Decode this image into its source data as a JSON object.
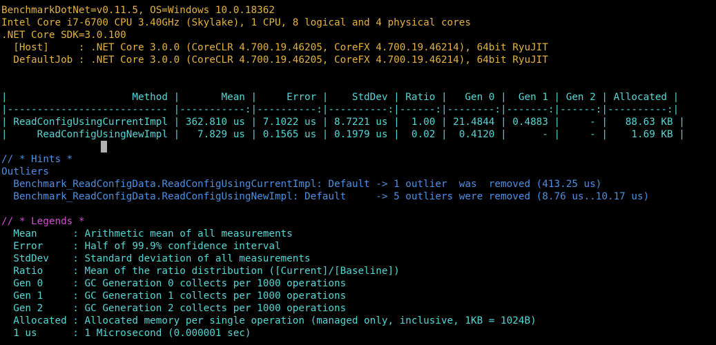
{
  "environment": {
    "line1": "BenchmarkDotNet=v0.11.5, OS=Windows 10.0.18362",
    "line2": "Intel Core i7-6700 CPU 3.40GHz (Skylake), 1 CPU, 8 logical and 4 physical cores",
    "line3": ".NET Core SDK=3.0.100",
    "line4": "  [Host]     : .NET Core 3.0.0 (CoreCLR 4.700.19.46205, CoreFX 4.700.19.46214), 64bit RyuJIT",
    "line5": "  DefaultJob : .NET Core 3.0.0 (CoreCLR 4.700.19.46205, CoreFX 4.700.19.46214), 64bit RyuJIT"
  },
  "table": {
    "header": "|                     Method |       Mean |     Error |    StdDev | Ratio |   Gen 0 |  Gen 1 | Gen 2 | Allocated |",
    "separator": "|--------------------------- |-----------:|----------:|----------:|------:|--------:|-------:|------:|----------:|",
    "rows": [
      "| ReadConfigUsingCurrentImpl | 362.810 us | 7.1022 us | 8.7221 us |  1.00 | 21.4844 | 0.4883 |     - |   88.63 KB |",
      "|     ReadConfigUsingNewImpl |   7.829 us | 0.1565 us | 0.1979 us |  0.02 |  0.4120 |      - |     - |    1.69 KB |"
    ]
  },
  "hints": {
    "title": "// * Hints *",
    "subtitle": "Outliers",
    "items": [
      "  Benchmark_ReadConfigData.ReadConfigUsingCurrentImpl: Default -> 1 outlier  was  removed (413.25 us)",
      "  Benchmark_ReadConfigData.ReadConfigUsingNewImpl: Default     -> 5 outliers were removed (8.76 us..10.17 us)"
    ]
  },
  "legends": {
    "title": "// * Legends *",
    "items": [
      "  Mean      : Arithmetic mean of all measurements",
      "  Error     : Half of 99.9% confidence interval",
      "  StdDev    : Standard deviation of all measurements",
      "  Ratio     : Mean of the ratio distribution ([Current]/[Baseline])",
      "  Gen 0     : GC Generation 0 collects per 1000 operations",
      "  Gen 1     : GC Generation 1 collects per 1000 operations",
      "  Gen 2     : GC Generation 2 collects per 1000 operations",
      "  Allocated : Allocated memory per single operation (managed only, inclusive, 1KB = 1024B)",
      "  1 us      : 1 Microsecond (0.000001 sec)"
    ]
  },
  "colors": {
    "background": "#000000",
    "environment_text": "#e3b341",
    "table_text": "#56d6d6",
    "hints_text": "#4f8fe0",
    "legends_title": "#d14fd1",
    "legends_text": "#56d6d6",
    "cursor": "#b0b0b0"
  }
}
